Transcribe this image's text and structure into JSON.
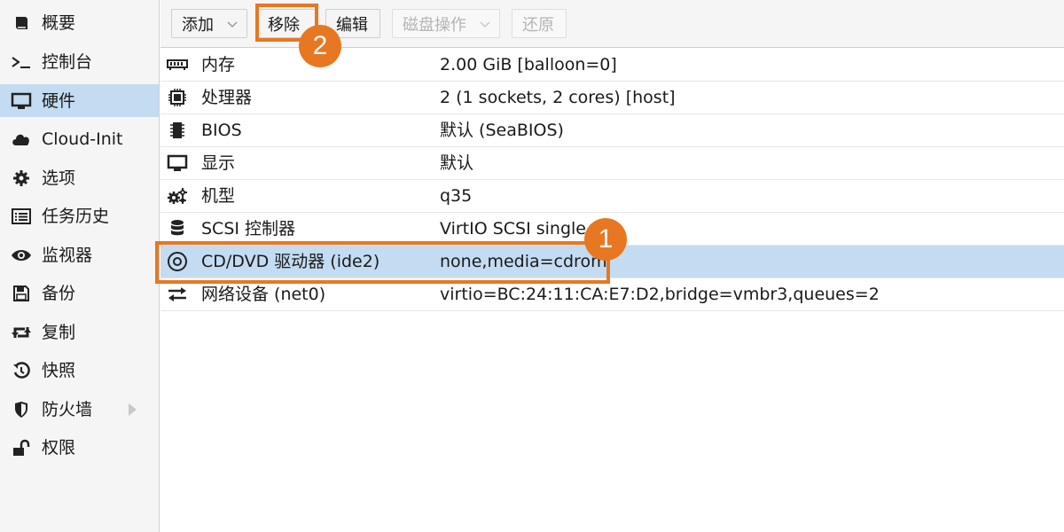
{
  "sidebar": {
    "items": [
      {
        "label": "概要",
        "icon": "book-icon"
      },
      {
        "label": "控制台",
        "icon": "terminal-icon"
      },
      {
        "label": "硬件",
        "icon": "monitor-icon",
        "active": true
      },
      {
        "label": "Cloud-Init",
        "icon": "cloud-icon"
      },
      {
        "label": "选项",
        "icon": "gear-icon"
      },
      {
        "label": "任务历史",
        "icon": "list-icon"
      },
      {
        "label": "监视器",
        "icon": "eye-icon"
      },
      {
        "label": "备份",
        "icon": "floppy-icon"
      },
      {
        "label": "复制",
        "icon": "retweet-icon"
      },
      {
        "label": "快照",
        "icon": "history-icon"
      },
      {
        "label": "防火墙",
        "icon": "shield-icon",
        "has_submenu": true
      },
      {
        "label": "权限",
        "icon": "unlock-icon"
      }
    ]
  },
  "toolbar": {
    "add_label": "添加",
    "remove_label": "移除",
    "edit_label": "编辑",
    "disk_action_label": "磁盘操作",
    "revert_label": "还原"
  },
  "hardware": {
    "rows": [
      {
        "name": "内存",
        "value": "2.00 GiB [balloon=0]",
        "icon": "memory-icon"
      },
      {
        "name": "处理器",
        "value": "2 (1 sockets, 2 cores) [host]",
        "icon": "cpu-icon"
      },
      {
        "name": "BIOS",
        "value": "默认 (SeaBIOS)",
        "icon": "microchip-icon"
      },
      {
        "name": "显示",
        "value": "默认",
        "icon": "desktop-icon"
      },
      {
        "name": "机型",
        "value": "q35",
        "icon": "cogs-icon"
      },
      {
        "name": "SCSI 控制器",
        "value": "VirtIO SCSI single",
        "icon": "database-icon"
      },
      {
        "name": "CD/DVD 驱动器 (ide2)",
        "value": "none,media=cdrom",
        "icon": "cdrom-icon",
        "selected": true
      },
      {
        "name": "网络设备 (net0)",
        "value": "virtio=BC:24:11:CA:E7:D2,bridge=vmbr3,queues=2",
        "icon": "exchange-icon"
      }
    ]
  },
  "annotations": {
    "step1": "1",
    "step2": "2"
  },
  "colors": {
    "accent": "#e87722",
    "selection": "#c3dcf1"
  }
}
